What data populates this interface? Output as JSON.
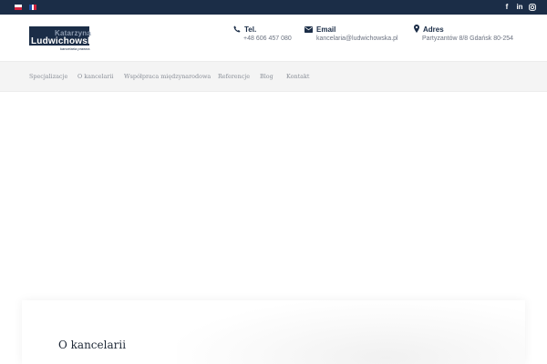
{
  "topbar": {
    "languages": [
      {
        "code": "pl",
        "colors": [
          "#ffffff",
          "#d4213d"
        ]
      },
      {
        "code": "fr",
        "colors": [
          "#1e4fa3",
          "#ffffff",
          "#d4213d"
        ]
      }
    ],
    "social": {
      "facebook": "f",
      "linkedin": "in",
      "instagram": "instagram-icon"
    }
  },
  "logo": {
    "line1": "Katarzyna",
    "line2": "Ludwichowska",
    "sub": "kancelaria prawna"
  },
  "contacts": {
    "tel": {
      "title": "Tel.",
      "value": "+48 606 457 080"
    },
    "email": {
      "title": "Email",
      "value": "kancelaria@ludwichowska.pl"
    },
    "address": {
      "title": "Adres",
      "value": "Partyzantów 8/8 Gdańsk 80-254"
    }
  },
  "nav": {
    "items": [
      {
        "label": "Specjalizacje"
      },
      {
        "label": "O kancelarii"
      },
      {
        "label": "Współpraca międzynarodowa"
      },
      {
        "label": "Referencje"
      },
      {
        "label": "Blog"
      },
      {
        "label": "Kontakt"
      }
    ]
  },
  "section": {
    "title": "O kancelarii"
  },
  "colors": {
    "brand": "#1b2d47",
    "muted": "#6b7280"
  }
}
